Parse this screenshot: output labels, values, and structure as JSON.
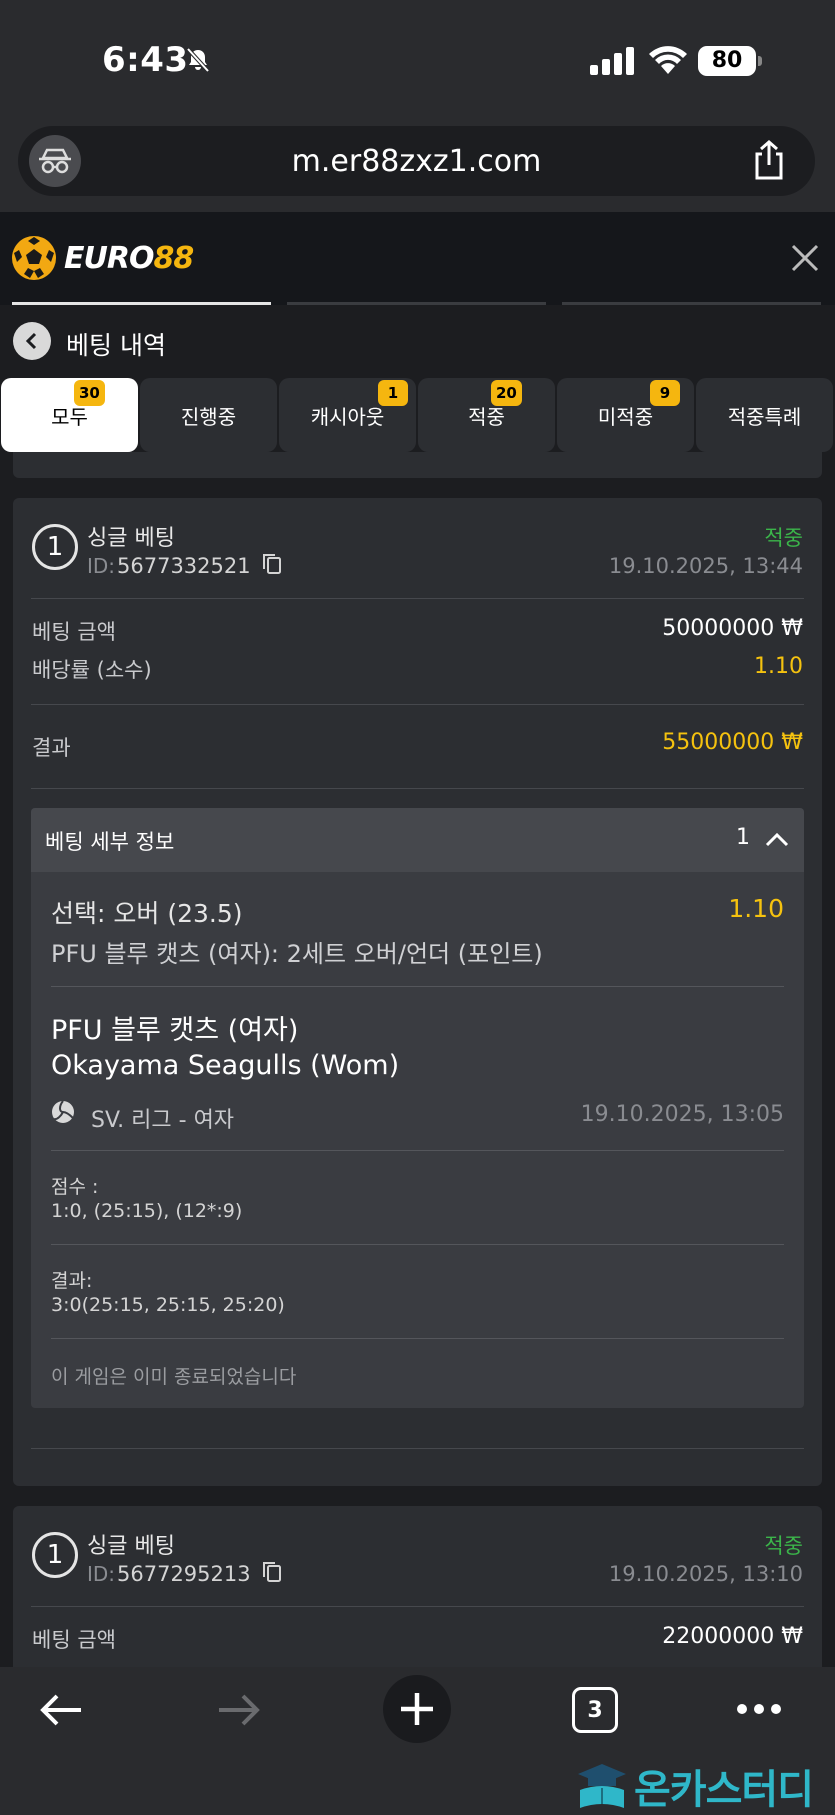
{
  "status_bar": {
    "time": "6:43",
    "battery": "80"
  },
  "browser": {
    "url": "m.er88zxz1.com",
    "tab_count": "3"
  },
  "app": {
    "logo_prefix": "EURO",
    "logo_suffix": "88"
  },
  "page": {
    "title": "베팅 내역"
  },
  "tabs": [
    {
      "label": "모두",
      "badge": "30",
      "active": true
    },
    {
      "label": "진행중",
      "badge": ""
    },
    {
      "label": "캐시아웃",
      "badge": "1"
    },
    {
      "label": "적중",
      "badge": "20"
    },
    {
      "label": "미적중",
      "badge": "9"
    },
    {
      "label": "적중특례",
      "badge": ""
    }
  ],
  "bets": [
    {
      "number": "1",
      "type": "싱글 베팅",
      "id_label": "ID:",
      "id": "5677332521",
      "status": "적중",
      "datetime": "19.10.2025, 13:44",
      "stake_label": "베팅 금액",
      "stake": "50000000 ₩",
      "odds_label": "배당률 (소수)",
      "odds": "1.10",
      "result_label": "결과",
      "result": "55000000 ₩",
      "detail": {
        "title": "베팅 세부 정보",
        "count": "1",
        "selection": "선택: 오버 (23.5)",
        "selection_odds": "1.10",
        "market": "PFU 블루 캣츠 (여자): 2세트 오버/언더 (포인트)",
        "team_home": "PFU 블루 캣츠 (여자)",
        "team_away": "Okayama Seagulls (Wom)",
        "league": "SV. 리그 - 여자",
        "event_datetime": "19.10.2025, 13:05",
        "score_label": "점수 :",
        "score": "1:0, (25:15), (12*:9)",
        "final_label": "결과:",
        "final": "3:0(25:15, 25:15, 25:20)",
        "note": "이 게임은 이미 종료되었습니다"
      }
    },
    {
      "number": "1",
      "type": "싱글 베팅",
      "id_label": "ID:",
      "id": "5677295213",
      "status": "적중",
      "datetime": "19.10.2025, 13:10",
      "stake_label": "베팅 금액",
      "stake": "22000000 ₩"
    }
  ],
  "watermark": "온카스터디",
  "colors": {
    "win_green": "#3bb54a",
    "accent_yellow": "#f5c20f",
    "badge_yellow": "#f5b60f"
  }
}
